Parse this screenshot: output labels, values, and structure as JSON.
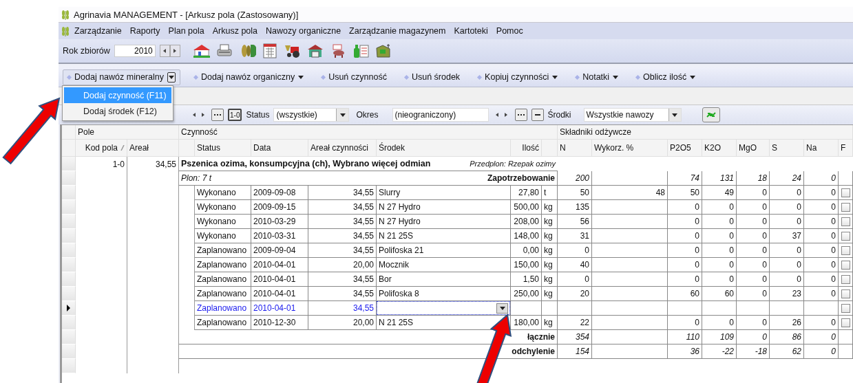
{
  "window": {
    "title": "Agrinavia MANAGEMENT - [Arkusz pola (Zastosowany)]"
  },
  "menu": [
    {
      "label": "Zarządzanie"
    },
    {
      "label": "Raporty"
    },
    {
      "label": "Plan pola"
    },
    {
      "label": "Arkusz pola"
    },
    {
      "label": "Nawozy organiczne"
    },
    {
      "label": "Zarządzanie magazynem"
    },
    {
      "label": "Kartoteki"
    },
    {
      "label": "Pomoc"
    }
  ],
  "toolbar": {
    "year_label": "Rok zbiorów",
    "year": "2010"
  },
  "actions": [
    {
      "label": "Dodaj nawóz mineralny",
      "kind": "split"
    },
    {
      "label": "Dodaj nawóz organiczny",
      "kind": "dropdown"
    },
    {
      "label": "Usuń czynność",
      "kind": "plain"
    },
    {
      "label": "Usuń środek",
      "kind": "plain"
    },
    {
      "label": "Kopiuj czynności",
      "kind": "dropdown"
    },
    {
      "label": "Notatki",
      "kind": "dropdown"
    },
    {
      "label": "Oblicz ilość",
      "kind": "dropdown"
    }
  ],
  "action_menu": [
    {
      "label": "Dodaj czynność (F11)",
      "selected": true
    },
    {
      "label": "Dodaj środek (F12)",
      "selected": false
    }
  ],
  "filters": {
    "code_button": "1-0",
    "status_label": "Status",
    "status": "(wszystkie)",
    "period_label": "Okres",
    "period": "(nieograniczony)",
    "agents_label": "Środki",
    "agents": "Wszystkie nawozy"
  },
  "table": {
    "groups": [
      "Pole",
      "Czynność",
      "Składniki odżywcze"
    ],
    "columns": [
      {
        "label": "Kod pola",
        "sorted": true
      },
      {
        "label": "Areał",
        "sorted": false
      },
      {
        "label": "Status",
        "sorted": false
      },
      {
        "label": "Data",
        "sorted": false
      },
      {
        "label": "Areał czynności",
        "sorted": false
      },
      {
        "label": "Środek",
        "sorted": false
      },
      {
        "label": "Ilość",
        "sorted": false
      },
      {
        "label": "N",
        "sorted": false
      },
      {
        "label": "Wykorz. %",
        "sorted": false
      },
      {
        "label": "P2O5",
        "sorted": false
      },
      {
        "label": "K2O",
        "sorted": false
      },
      {
        "label": "MgO",
        "sorted": false
      },
      {
        "label": "S",
        "sorted": false
      },
      {
        "label": "Na",
        "sorted": false
      },
      {
        "label": "F",
        "sorted": false
      }
    ],
    "field": {
      "code": "1-0",
      "area": "34,55",
      "crop": "Pszenica ozima, konsumpcyjna (ch), Wybrano więcej odmian",
      "previous_crop": "Przedplon: Rzepak ozimy"
    },
    "requirement": {
      "yield": "Plon: 7 t",
      "label": "Zapotrzebowanie",
      "n": "200",
      "p2o5": "74",
      "k2o": "131",
      "mgo": "18",
      "s": "24",
      "na": "0"
    },
    "activities": [
      {
        "status": "Wykonano",
        "date": "2009-09-08",
        "area": "34,55",
        "agent": "Slurry",
        "amount": "27,80",
        "unit": "t",
        "n": "50",
        "utilization": "48",
        "p2o5": "50",
        "k2o": "49",
        "mgo": "0",
        "s": "0",
        "na": "0",
        "f": false,
        "current": false
      },
      {
        "status": "Wykonano",
        "date": "2009-09-15",
        "area": "34,55",
        "agent": "N 27 Hydro",
        "amount": "500,00",
        "unit": "kg",
        "n": "135",
        "p2o5": "0",
        "k2o": "0",
        "mgo": "0",
        "s": "0",
        "na": "0",
        "f": false,
        "current": false
      },
      {
        "status": "Wykonano",
        "date": "2010-03-29",
        "area": "34,55",
        "agent": "N 27 Hydro",
        "amount": "208,00",
        "unit": "kg",
        "n": "56",
        "p2o5": "0",
        "k2o": "0",
        "mgo": "0",
        "s": "0",
        "na": "0",
        "f": false,
        "current": false
      },
      {
        "status": "Wykonano",
        "date": "2010-03-31",
        "area": "34,55",
        "agent": "N 21 25S",
        "amount": "148,00",
        "unit": "kg",
        "n": "31",
        "p2o5": "0",
        "k2o": "0",
        "mgo": "0",
        "s": "37",
        "na": "0",
        "f": false,
        "current": false
      },
      {
        "status": "Zaplanowano",
        "date": "2009-09-04",
        "area": "34,55",
        "agent": "Polifoska 21",
        "amount": "0,00",
        "unit": "kg",
        "n": "0",
        "p2o5": "0",
        "k2o": "0",
        "mgo": "0",
        "s": "0",
        "na": "0",
        "f": false,
        "current": false
      },
      {
        "status": "Zaplanowano",
        "date": "2010-04-01",
        "area": "20,00",
        "agent": "Mocznik",
        "amount": "150,00",
        "unit": "kg",
        "n": "40",
        "p2o5": "0",
        "k2o": "0",
        "mgo": "0",
        "s": "0",
        "na": "0",
        "f": false,
        "current": false
      },
      {
        "status": "Zaplanowano",
        "date": "2010-04-01",
        "area": "34,55",
        "agent": "Bor",
        "amount": "1,50",
        "unit": "kg",
        "n": "0",
        "p2o5": "0",
        "k2o": "0",
        "mgo": "0",
        "s": "0",
        "na": "0",
        "f": false,
        "current": false
      },
      {
        "status": "Zaplanowano",
        "date": "2010-04-01",
        "area": "34,55",
        "agent": "Polifoska 8",
        "amount": "250,00",
        "unit": "kg",
        "n": "20",
        "p2o5": "60",
        "k2o": "60",
        "mgo": "0",
        "s": "23",
        "na": "0",
        "f": false,
        "current": false
      },
      {
        "status": "Zaplanowano",
        "date": "2010-04-01",
        "area": "34,55",
        "f": false,
        "current": true
      },
      {
        "status": "Zaplanowano",
        "date": "2010-12-30",
        "area": "20,00",
        "agent": "N 21 25S",
        "amount": "180,00",
        "unit": "kg",
        "n": "22",
        "p2o5": "0",
        "k2o": "0",
        "mgo": "0",
        "s": "26",
        "na": "0",
        "f": false,
        "current": false
      }
    ],
    "totals": [
      {
        "label": "łącznie",
        "n": "354",
        "p2o5": "110",
        "k2o": "109",
        "mgo": "0",
        "s": "86",
        "na": "0"
      },
      {
        "label": "odchylenie",
        "n": "154",
        "p2o5": "36",
        "k2o": "-22",
        "mgo": "-18",
        "s": "62",
        "na": "0"
      }
    ]
  }
}
